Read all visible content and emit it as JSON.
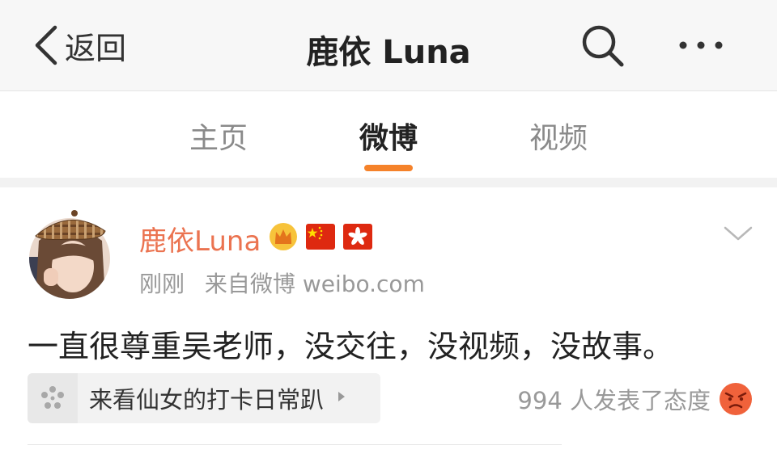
{
  "nav": {
    "back_label": "返回",
    "title": "鹿依 Luna",
    "search_icon": "search-icon",
    "more_icon": "more-icon"
  },
  "tabs": [
    {
      "label": "主页",
      "active": false
    },
    {
      "label": "微博",
      "active": true
    },
    {
      "label": "视频",
      "active": false
    }
  ],
  "post": {
    "username": "鹿依Luna",
    "badges": [
      "crown-icon",
      "china-flag-icon",
      "hong-kong-flag-icon"
    ],
    "time": "刚刚",
    "source": "来自微博 weibo.com",
    "text": "一直很尊重吴老师，没交往，没视频，没故事。",
    "topic_label": "来看仙女的打卡日常趴",
    "reactions_text": "994 人发表了态度",
    "reaction_icon": "angry-face-icon"
  },
  "colors": {
    "accent": "#f5822a",
    "username": "#eb7350",
    "muted": "#999999"
  }
}
